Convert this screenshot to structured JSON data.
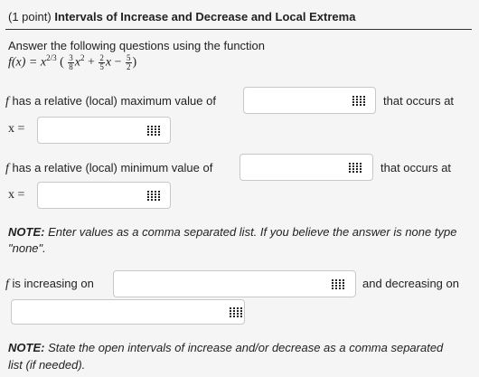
{
  "header": {
    "points": "(1 point)",
    "title": "Intervals of Increase and Decrease and Local Extrema"
  },
  "intro": "Answer the following questions using the function",
  "function": {
    "lhs": "f(x) = x",
    "exponent": "2/3",
    "open": "(",
    "c1_num": "3",
    "c1_den": "8",
    "term1": "x",
    "term1_exp": "2",
    "plus": "+",
    "c2_num": "2",
    "c2_den": "5",
    "term2": "x",
    "minus": "−",
    "c3_num": "5",
    "c3_den": "2",
    "close": ")"
  },
  "max": {
    "f": "f",
    "label": "has a relative (local) maximum value of",
    "occurs": "that occurs at",
    "x_label": "x ="
  },
  "min": {
    "f": "f",
    "label": "has a relative (local) minimum value of",
    "occurs": "that occurs at",
    "x_label": "x ="
  },
  "note1": {
    "bold": "NOTE:",
    "text": "Enter values as a comma separated list. If you believe the answer is none type \"none\"."
  },
  "increasing": {
    "f": "f",
    "label": "is increasing on",
    "decreasing": "and decreasing on"
  },
  "note2": {
    "bold": "NOTE:",
    "text": "State the open intervals of increase and/or decrease as a comma separated list (if needed)."
  },
  "icons": {
    "keyboard": "keyboard-icon"
  }
}
